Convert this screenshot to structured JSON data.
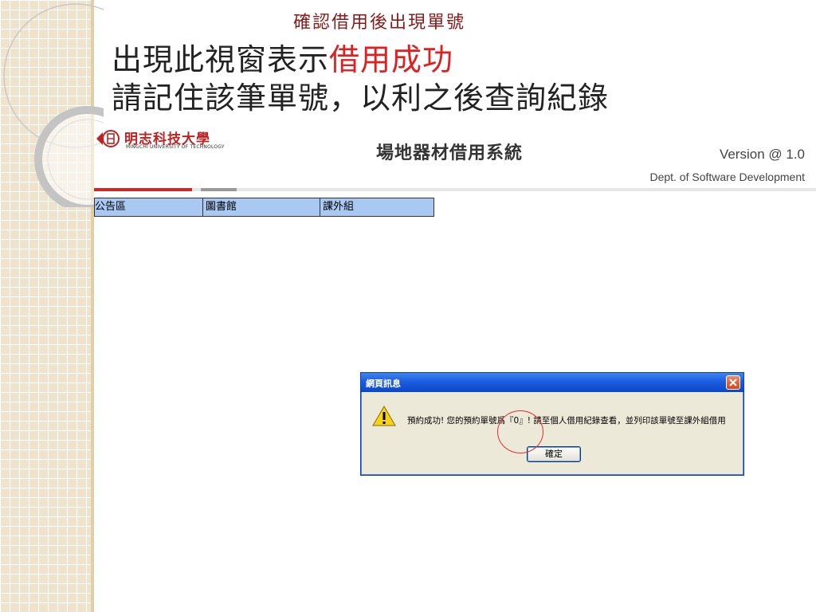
{
  "annotations": {
    "top_note": "確認借用後出現單號",
    "line1_prefix": "出現此視窗表示",
    "line1_highlight": "借用成功",
    "line2": "請記住該筆單號，以利之後查詢紀錄"
  },
  "header": {
    "logo_name": "明志科技大學",
    "logo_sub": "MINGCHI UNIVERSITY OF TECHNOLOGY",
    "system_title": "場地器材借用系統",
    "version": "Version @ 1.0",
    "dept": "Dept. of Software Development"
  },
  "nav": {
    "items": [
      {
        "label": "公告區"
      },
      {
        "label": "圖書館"
      },
      {
        "label": "課外組"
      }
    ]
  },
  "dialog": {
    "title": "網頁訊息",
    "message": "預約成功! 您的預約單號爲『0』! 請至個人借用紀錄查看，並列印該單號至課外組借用",
    "ok_label": "確定"
  },
  "colors": {
    "accent_red": "#e02020",
    "nav_bg": "#a9c9f2",
    "dialog_title_blue": "#1d5de0"
  }
}
